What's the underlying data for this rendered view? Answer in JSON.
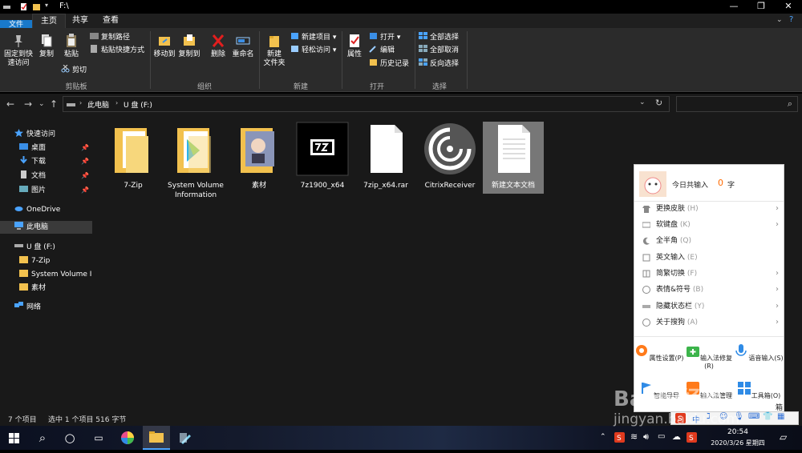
{
  "window": {
    "path": "F:\\"
  },
  "tabs": [
    {
      "label": "文件"
    },
    {
      "label": "主页"
    },
    {
      "label": "共享"
    },
    {
      "label": "查看"
    }
  ],
  "ribbon": {
    "clipboard": {
      "pin_label_1": "固定到快",
      "pin_label_2": "速访问",
      "copy": "复制",
      "paste": "粘贴",
      "copy_path": "复制路径",
      "paste_shortcut": "粘贴快捷方式",
      "cut": "剪切",
      "group": "剪贴板"
    },
    "organize": {
      "move_to": "移动到",
      "copy_to": "复制到",
      "delete": "删除",
      "rename": "重命名",
      "group": "组织"
    },
    "new": {
      "new_folder_1": "新建",
      "new_folder_2": "文件夹",
      "new_item": "新建项目",
      "easy_access": "轻松访问",
      "group": "新建"
    },
    "open": {
      "properties": "属性",
      "open": "打开",
      "edit": "编辑",
      "history": "历史记录",
      "group": "打开"
    },
    "select": {
      "select_all": "全部选择",
      "select_none": "全部取消",
      "invert": "反向选择",
      "group": "选择"
    }
  },
  "address": {
    "crumb_1": "此电脑",
    "crumb_2": "U 盘 (F:)"
  },
  "nav": {
    "quick_access": "快速访问",
    "desktop": "桌面",
    "downloads": "下载",
    "documents": "文档",
    "pictures": "图片",
    "onedrive": "OneDrive",
    "this_pc": "此电脑",
    "usb": "U 盘 (F:)",
    "sub_7zip": "7-Zip",
    "sub_svi": "System Volume In",
    "sub_sucai": "素材",
    "network": "网络"
  },
  "files": [
    {
      "name": "7-Zip"
    },
    {
      "name": "System Volume Information"
    },
    {
      "name": "素材"
    },
    {
      "name": "7z1900_x64"
    },
    {
      "name": "7zip_x64.rar"
    },
    {
      "name": "CitrixReceiver"
    },
    {
      "name": "新建文本文档"
    }
  ],
  "status": {
    "count": "7 个项目",
    "selected": "选中 1 个项目 516 字节"
  },
  "ime": {
    "today_prefix": "今日共输入",
    "today_count": "0",
    "today_suffix": "字",
    "items": [
      {
        "label": "更换皮肤",
        "key": "(H)",
        "submenu": true
      },
      {
        "label": "软键盘",
        "key": "(K)",
        "submenu": true
      },
      {
        "label": "全半角",
        "key": "(Q)",
        "submenu": false
      },
      {
        "label": "英文输入",
        "key": "(E)",
        "submenu": false
      },
      {
        "label": "简繁切换",
        "key": "(F)",
        "submenu": true
      },
      {
        "label": "表情&符号",
        "key": "(B)",
        "submenu": true
      },
      {
        "label": "隐藏状态栏",
        "key": "(Y)",
        "submenu": true
      },
      {
        "label": "关于搜狗",
        "key": "(A)",
        "submenu": true
      }
    ],
    "cells": [
      {
        "label": "属性设置(P)"
      },
      {
        "label": "输入法修复(R)"
      },
      {
        "label": "语音输入(S)"
      },
      {
        "label": "智能导导"
      },
      {
        "label": "输入法管理"
      },
      {
        "label": "工具箱(O)"
      }
    ],
    "ime_bar_extra": "箱"
  },
  "taskbar": {
    "time": "20:54",
    "date": "2020/3/26 星期四"
  },
  "watermark": {
    "line1": "Baidu经验",
    "line2": "jingyan.baidu.com"
  }
}
